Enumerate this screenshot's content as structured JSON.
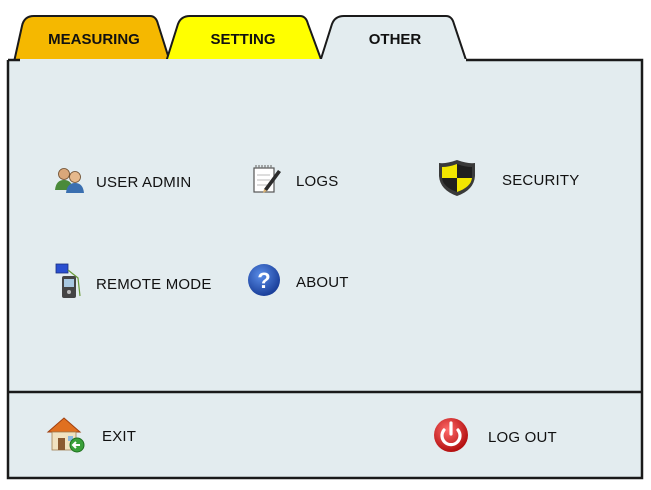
{
  "tabs": [
    {
      "label": "MEASURING",
      "color": "#f5b800"
    },
    {
      "label": "SETTING",
      "color": "#ffff00"
    },
    {
      "label": "OTHER",
      "color": "#e3ecef"
    }
  ],
  "active_tab": "OTHER",
  "menu": {
    "user_admin": {
      "label": "USER ADMIN",
      "icon": "users-icon"
    },
    "logs": {
      "label": "LOGS",
      "icon": "notepad-pen-icon"
    },
    "security": {
      "label": "SECURITY",
      "icon": "shield-icon"
    },
    "remote_mode": {
      "label": "REMOTE MODE",
      "icon": "remote-device-icon"
    },
    "about": {
      "label": "ABOUT",
      "icon": "help-question-icon"
    }
  },
  "footer": {
    "exit": {
      "label": "EXIT",
      "icon": "home-exit-icon"
    },
    "logout": {
      "label": "LOG OUT",
      "icon": "power-icon"
    }
  },
  "colors": {
    "panel_bg": "#e3ecef",
    "border": "#1a1a1a",
    "measuring_tab": "#f5b800",
    "setting_tab": "#ffff00"
  }
}
